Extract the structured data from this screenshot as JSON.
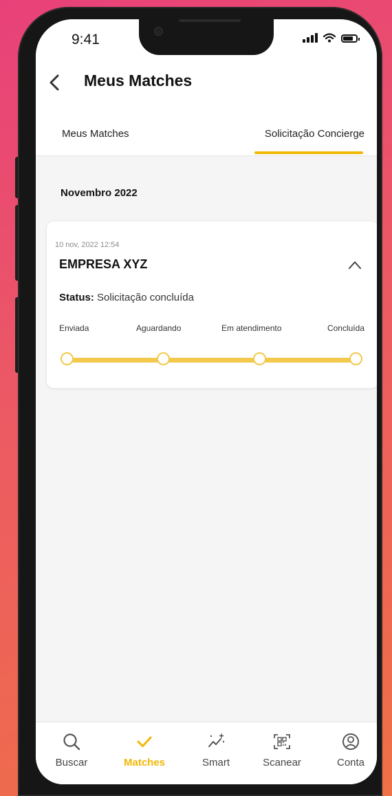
{
  "status_bar": {
    "time": "9:41"
  },
  "header": {
    "title": "Meus Matches"
  },
  "tabs": [
    {
      "label": "Meus Matches",
      "active": false
    },
    {
      "label": "Solicitação Concierge",
      "active": true
    }
  ],
  "section": {
    "month": "Novembro 2022"
  },
  "card": {
    "datetime": "10 nov, 2022  12:54",
    "company": "EMPRESA XYZ",
    "status_label": "Status:",
    "status_value": " Solicitação concluída",
    "steps": [
      "Enviada",
      "Aguardando",
      "Em atendimento",
      "Concluída"
    ]
  },
  "nav": [
    {
      "label": "Buscar",
      "icon": "search-icon"
    },
    {
      "label": "Matches",
      "icon": "check-icon",
      "active": true
    },
    {
      "label": "Smart",
      "icon": "sparkle-chart-icon"
    },
    {
      "label": "Scanear",
      "icon": "qr-scan-icon"
    },
    {
      "label": "Conta",
      "icon": "user-circle-icon"
    }
  ],
  "colors": {
    "accent": "#f2b705",
    "track": "#f2c94c"
  }
}
